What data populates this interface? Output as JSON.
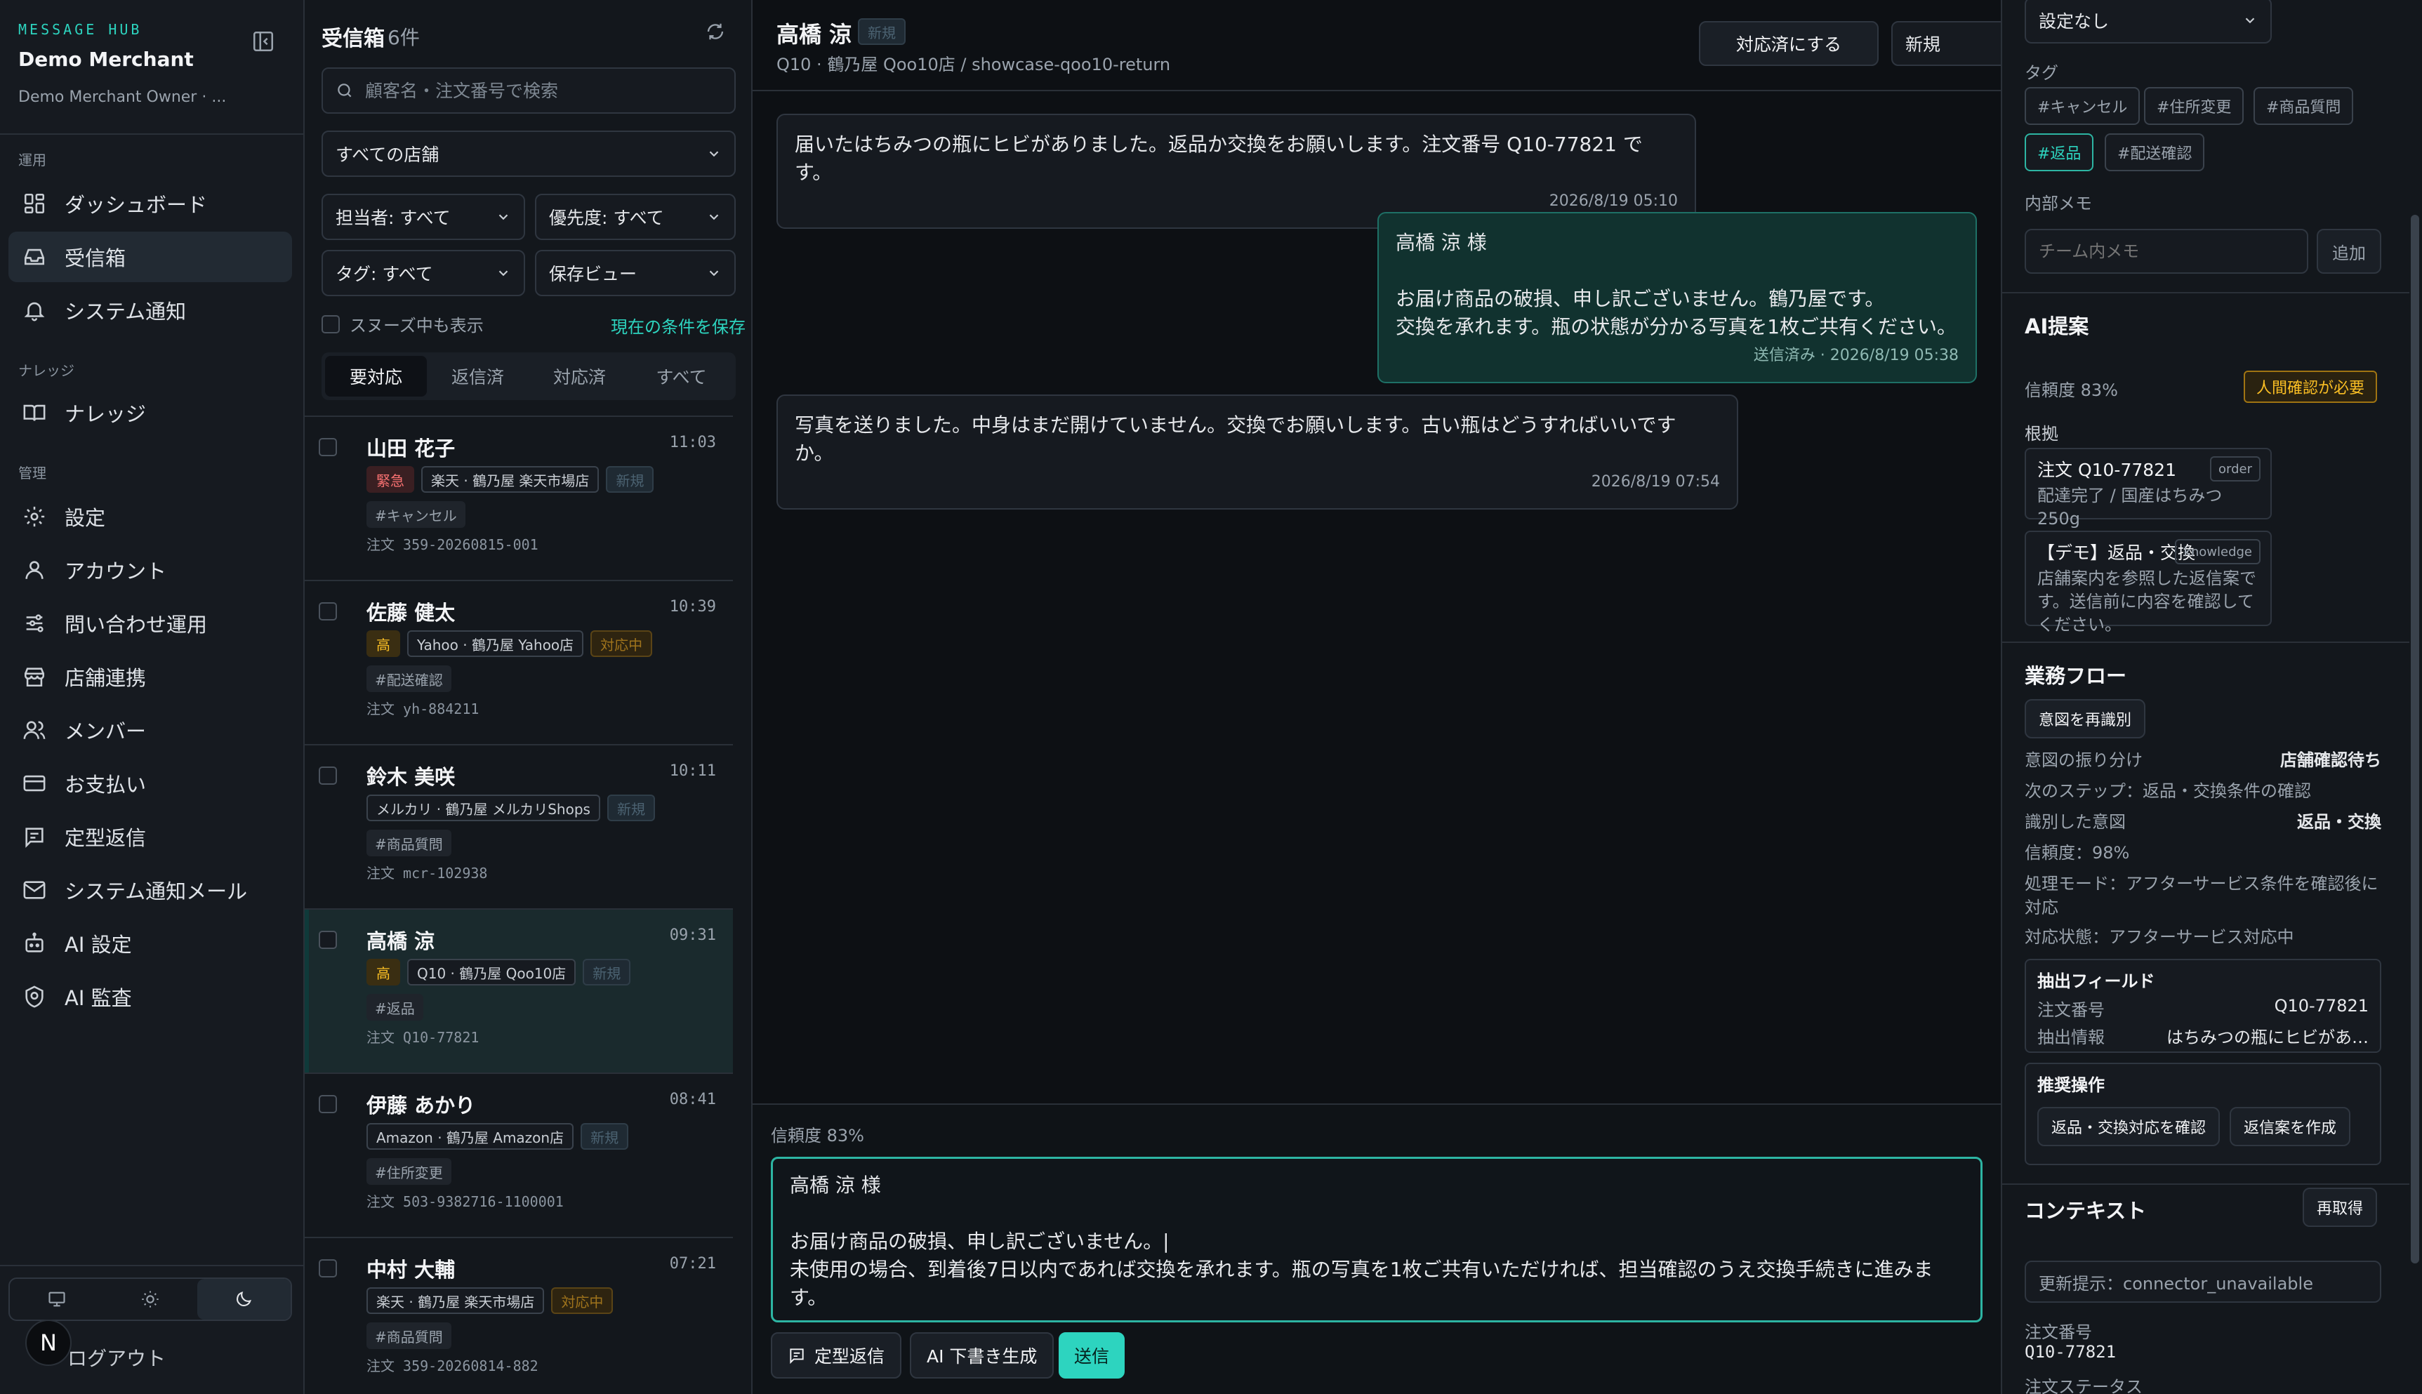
{
  "sidebar": {
    "brand_tag": "MESSAGE HUB",
    "brand_name": "Demo Merchant",
    "brand_user": "Demo Merchant Owner · ...",
    "sections": [
      {
        "label": "運用",
        "items": [
          {
            "label": "ダッシュボード",
            "icon": "dashboard-icon"
          },
          {
            "label": "受信箱",
            "icon": "inbox-icon",
            "active": true
          },
          {
            "label": "システム通知",
            "icon": "bell-icon"
          }
        ]
      },
      {
        "label": "ナレッジ",
        "items": [
          {
            "label": "ナレッジ",
            "icon": "book-icon"
          }
        ]
      },
      {
        "label": "管理",
        "items": [
          {
            "label": "設定",
            "icon": "gear-icon"
          },
          {
            "label": "アカウント",
            "icon": "user-icon"
          },
          {
            "label": "問い合わせ運用",
            "icon": "sliders-icon"
          },
          {
            "label": "店舗連携",
            "icon": "store-icon"
          },
          {
            "label": "メンバー",
            "icon": "users-icon"
          },
          {
            "label": "お支払い",
            "icon": "card-icon"
          },
          {
            "label": "定型返信",
            "icon": "template-icon"
          },
          {
            "label": "システム通知メール",
            "icon": "mail-icon"
          },
          {
            "label": "AI 設定",
            "icon": "bot-icon"
          },
          {
            "label": "AI 監査",
            "icon": "audit-icon"
          }
        ]
      }
    ],
    "theme": {
      "selected": "dark",
      "options": [
        "monitor-icon",
        "sun-icon",
        "moon-icon"
      ]
    },
    "avatar_letter": "N",
    "logout_label": "ログアウト"
  },
  "inbox": {
    "title": "受信箱",
    "count": "6件",
    "search_placeholder": "顧客名・注文番号で検索",
    "store_filter": "すべての店舗",
    "assignee_filter": "担当者: すべて",
    "priority_filter": "優先度: すべて",
    "tag_filter": "タグ: すべて",
    "saved_view": "保存ビュー",
    "snooze_label": "スヌーズ中も表示",
    "save_conditions": "現在の条件を保存",
    "tabs": [
      "要対応",
      "返信済",
      "対応済",
      "すべて"
    ],
    "active_tab": 0,
    "conversations": [
      {
        "name": "山田 花子",
        "time": "11:03",
        "priority": "緊急",
        "priority_kind": "urgent",
        "channel": "楽天 · 鶴乃屋 楽天市場店",
        "status": "新規",
        "status_kind": "new",
        "tag": "#キャンセル",
        "order": "注文 359-20260815-001"
      },
      {
        "name": "佐藤 健太",
        "time": "10:39",
        "priority": "高",
        "priority_kind": "high",
        "channel": "Yahoo · 鶴乃屋 Yahoo店",
        "status": "対応中",
        "status_kind": "prog",
        "tag": "#配送確認",
        "order": "注文 yh-884211"
      },
      {
        "name": "鈴木 美咲",
        "time": "10:11",
        "priority": "",
        "priority_kind": "",
        "channel": "メルカリ · 鶴乃屋 メルカリShops",
        "status": "新規",
        "status_kind": "new",
        "tag": "#商品質問",
        "order": "注文 mcr-102938"
      },
      {
        "name": "高橋 涼",
        "time": "09:31",
        "priority": "高",
        "priority_kind": "high",
        "channel": "Q10 · 鶴乃屋 Qoo10店",
        "status": "新規",
        "status_kind": "new",
        "tag": "#返品",
        "order": "注文 Q10-77821",
        "selected": true
      },
      {
        "name": "伊藤 あかり",
        "time": "08:41",
        "priority": "",
        "priority_kind": "",
        "channel": "Amazon · 鶴乃屋 Amazon店",
        "status": "新規",
        "status_kind": "new",
        "tag": "#住所変更",
        "order": "注文 503-9382716-1100001"
      },
      {
        "name": "中村 大輔",
        "time": "07:21",
        "priority": "",
        "priority_kind": "",
        "channel": "楽天 · 鶴乃屋 楽天市場店",
        "status": "対応中",
        "status_kind": "prog",
        "tag": "#商品質問",
        "order": "注文 359-20260814-882"
      }
    ]
  },
  "chat": {
    "customer": "高橋 涼",
    "status_badge": "新規",
    "subtitle": "Q10 · 鶴乃屋 Qoo10店 / showcase-qoo10-return",
    "mark_done": "対応済にする",
    "status_select": "新規",
    "messages": [
      {
        "dir": "in",
        "text": "届いたはちみつの瓶にヒビがありました。返品か交換をお願いします。注文番号 Q10-77821 です。",
        "meta": "2026/8/19 05:10"
      },
      {
        "dir": "out",
        "text": "高橋 涼 様\n\nお届け商品の破損、申し訳ございません。鶴乃屋です。\n交換を承れます。瓶の状態が分かる写真を1枚ご共有ください。",
        "meta": "送信済み · 2026/8/19 05:38"
      },
      {
        "dir": "in",
        "text": "写真を送りました。中身はまだ開けていません。交換でお願いします。古い瓶はどうすればいいです\nか。",
        "meta": "2026/8/19 07:54"
      }
    ],
    "confidence": "信頼度 83%",
    "draft": "高橋 涼 様\n\nお届け商品の破損、申し訳ございません。|\n未使用の場合、到着後7日以内であれば交換を承れます。瓶の写真を1枚ご共有いただければ、担当確認のうえ交換手続きに進みま\nす。",
    "template_button": "定型返信",
    "ai_draft_button": "AI 下書き生成",
    "send_button": "送信"
  },
  "right": {
    "assignee_select": "設定なし",
    "tags_label": "タグ",
    "tags": [
      {
        "label": "#キャンセル",
        "on": false
      },
      {
        "label": "#住所変更",
        "on": false
      },
      {
        "label": "#商品質問",
        "on": false
      },
      {
        "label": "#返品",
        "on": true
      },
      {
        "label": "#配送確認",
        "on": false
      }
    ],
    "memo_label": "内部メモ",
    "memo_placeholder": "チーム内メモ",
    "memo_add": "追加",
    "ai_title": "AI提案",
    "ai_confidence": "信頼度 83%",
    "ai_warning": "人間確認が必要",
    "evidence_label": "根拠",
    "evidence": [
      {
        "title": "注文 Q10-77821",
        "kind": "order",
        "desc": "配達完了 / 国産はちみつ 250g"
      },
      {
        "title": "【デモ】返品・交換",
        "kind": "knowledge",
        "desc": "店舗案内を参照した返信案です。送信前に内容を確認してください。"
      }
    ],
    "flow_title": "業務フロー",
    "reidentify": "意図を再識別",
    "flow": {
      "routing_label": "意図の振り分け",
      "routing_value": "店舗確認待ち",
      "next_step": "次のステップ：返品・交換条件の確認",
      "intent_label": "識別した意図",
      "intent_value": "返品・交換",
      "confidence": "信頼度：98%",
      "mode": "処理モード：アフターサービス条件を確認後に対応",
      "state": "対応状態：アフターサービス対応中"
    },
    "extract_title": "抽出フィールド",
    "extract": [
      {
        "k": "注文番号",
        "v": "Q10-77821"
      },
      {
        "k": "抽出情報",
        "v": "はちみつの瓶にヒビがあ…"
      }
    ],
    "actions_title": "推奨操作",
    "actions": [
      "返品・交換対応を確認",
      "返信案を作成"
    ],
    "context_title": "コンテキスト",
    "refetch": "再取得",
    "update_hint": "更新提示：connector_unavailable",
    "order_no_label": "注文番号",
    "order_no": "Q10-77821",
    "order_status_label": "注文ステータス"
  }
}
